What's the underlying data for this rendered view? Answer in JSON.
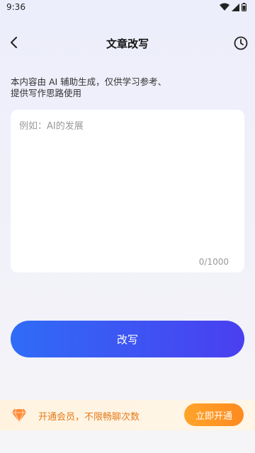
{
  "status_bar": {
    "time": "9:36"
  },
  "header": {
    "title": "文章改写"
  },
  "notice": {
    "text": "本内容由 AI 辅助生成，仅供学习参考、\n提供写作思路使用"
  },
  "editor": {
    "placeholder": "例如：AI的发展",
    "value": "",
    "counter": "0/1000"
  },
  "actions": {
    "rewrite_label": "改写"
  },
  "vip": {
    "promo_text": "开通会员，不限畅聊次数",
    "button_label": "立即开通"
  },
  "colors": {
    "primary_start": "#2f6cf6",
    "primary_end": "#4a3ff0",
    "vip_orange": "#ff8a1f"
  },
  "icons": {
    "back": "chevron-left-icon",
    "history": "clock-icon",
    "vip": "diamond-icon"
  }
}
